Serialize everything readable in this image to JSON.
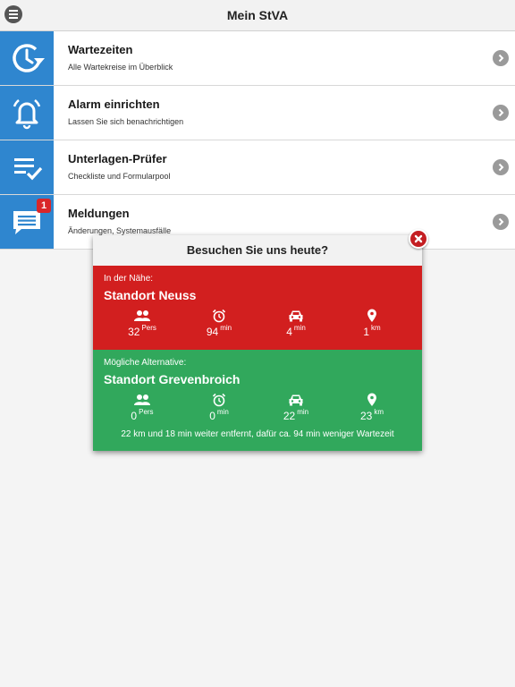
{
  "header": {
    "title": "Mein StVA"
  },
  "menu": [
    {
      "title": "Wartezeiten",
      "subtitle": "Alle Wartekreise im Überblick"
    },
    {
      "title": "Alarm einrichten",
      "subtitle": "Lassen Sie sich benachrichtigen"
    },
    {
      "title": "Unterlagen-Prüfer",
      "subtitle": "Checkliste und Formularpool"
    },
    {
      "title": "Meldungen",
      "subtitle": "Änderungen, Systemausfälle",
      "badge": "1"
    }
  ],
  "popup": {
    "title": "Besuchen Sie uns heute?",
    "nearby": {
      "label": "In der Nähe:",
      "name": "Standort Neuss",
      "persons": "32",
      "persons_unit": "Pers",
      "wait": "94",
      "wait_unit": "min",
      "drive": "4",
      "drive_unit": "min",
      "distance": "1",
      "distance_unit": "km"
    },
    "alternative": {
      "label": "Mögliche Alternative:",
      "name": "Standort Grevenbroich",
      "persons": "0",
      "persons_unit": "Pers",
      "wait": "0",
      "wait_unit": "min",
      "drive": "22",
      "drive_unit": "min",
      "distance": "23",
      "distance_unit": "km",
      "note": "22 km und 18 min weiter entfernt, dafür ca. 94 min weniger Wartezeit"
    }
  },
  "colors": {
    "tile": "#2f86cf",
    "nearby": "#d21f1f",
    "alternative": "#31a85c",
    "badge": "#d9262a"
  },
  "icons": [
    "menu-icon",
    "clock-refresh-icon",
    "bell-icon",
    "checklist-icon",
    "chat-icon",
    "chevron-right-icon",
    "close-icon",
    "people-icon",
    "alarm-clock-icon",
    "car-icon",
    "location-pin-icon"
  ]
}
